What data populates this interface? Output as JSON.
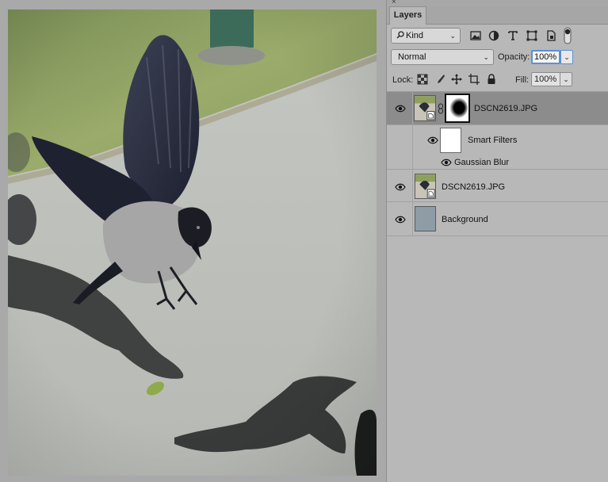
{
  "panel": {
    "close_glyph": "×",
    "tab_label": "Layers",
    "kind_filter": {
      "icon": "search-icon",
      "label": "Kind"
    },
    "filter_icons": [
      "image-filter-icon",
      "adjustment-filter-icon",
      "type-filter-icon",
      "shape-filter-icon",
      "smart-object-filter-icon",
      "filter-toggle-icon"
    ],
    "blend_mode": "Normal",
    "opacity_label": "Opacity:",
    "opacity_value": "100%",
    "lock_label": "Lock:",
    "lock_icons": [
      "lock-transparent-icon",
      "lock-image-icon",
      "lock-position-icon",
      "lock-artboard-icon",
      "lock-all-icon"
    ],
    "fill_label": "Fill:",
    "fill_value": "100%",
    "dropdown_glyph": "⌄",
    "colors": {
      "selected_row": "#8c8c8c",
      "panel_bg": "#b8b8b8",
      "focus_ring": "#5b8fd6",
      "background_layer_fill": "#8e9ca6"
    }
  },
  "layers": [
    {
      "name": "DSCN2619.JPG",
      "type": "smart-object",
      "selected": true,
      "has_mask": true
    },
    {
      "name": "Smart Filters",
      "type": "smart-filters",
      "filters": [
        {
          "name": "Gaussian Blur"
        }
      ]
    },
    {
      "name": "DSCN2619.JPG",
      "type": "smart-object",
      "selected": false
    },
    {
      "name": "Background",
      "type": "background"
    }
  ]
}
